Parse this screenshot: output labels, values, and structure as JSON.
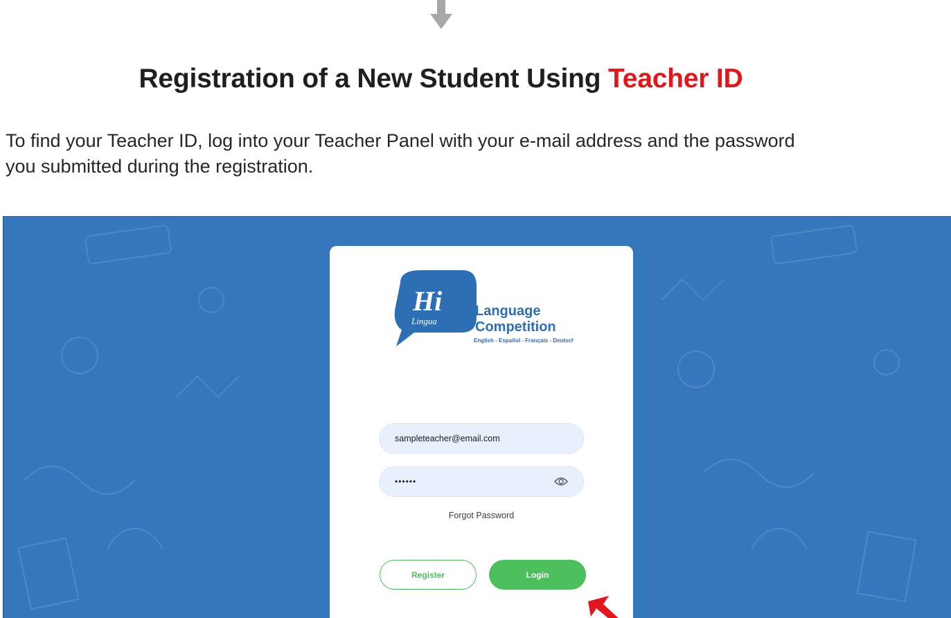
{
  "heading": {
    "main": "Registration of a New Student Using ",
    "accent": "Teacher ID"
  },
  "intro": {
    "line1": "To find your Teacher ID, log into your Teacher Panel with your e-mail address and the password",
    "line2": "you submitted during the registration."
  },
  "logo": {
    "hi": "Hi",
    "lingua": "Lingua",
    "line1": "Language",
    "line2": "Competition",
    "languages": "English - Español - Français - Deutsch"
  },
  "login_form": {
    "email_value": "sampleteacher@email.com",
    "password_value": "••••••",
    "forgot_label": "Forgot Password",
    "register_label": "Register",
    "login_label": "Login"
  },
  "colors": {
    "accent_red": "#e3161b",
    "panel_blue": "#3577bc",
    "button_green": "#4bbf5b",
    "input_fill": "#e8f0fe"
  },
  "icons": [
    "down-arrow-icon",
    "eye-icon",
    "pointer-arrow-icon"
  ]
}
